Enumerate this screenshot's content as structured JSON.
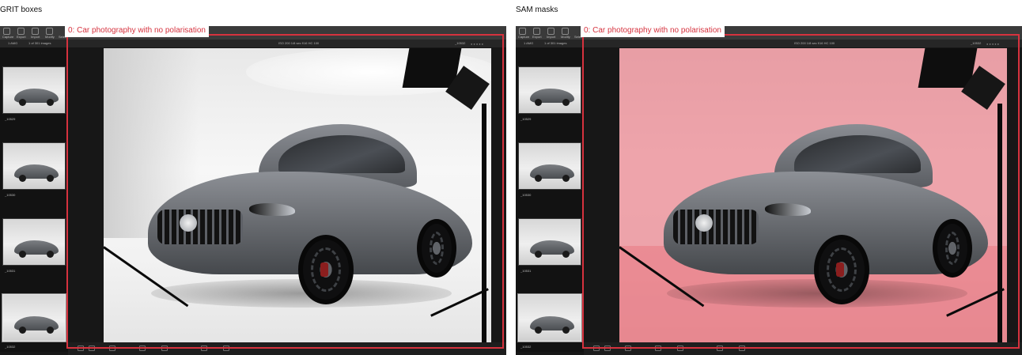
{
  "left_panel": {
    "title": "GRIT boxes"
  },
  "right_panel": {
    "title": "SAM masks"
  },
  "detection": {
    "label": "0: Car photography with no polarisation",
    "box_color": "#d6323e",
    "mask_color": "#e8606e"
  },
  "app": {
    "toolbar_items": [
      "Capture",
      "Export",
      "Import",
      "Modify",
      "Select"
    ],
    "counter": "1 of 301 images",
    "mode": "1 AMG",
    "exposure": "ISO 200  1/8 sec  f/16  HC 100",
    "filename": "_10532"
  },
  "filmstrip": [
    {
      "label": "_10529",
      "selected": false
    },
    {
      "label": "_10530",
      "selected": false
    },
    {
      "label": "_10531",
      "selected": false
    },
    {
      "label": "_10532",
      "selected": true
    }
  ]
}
